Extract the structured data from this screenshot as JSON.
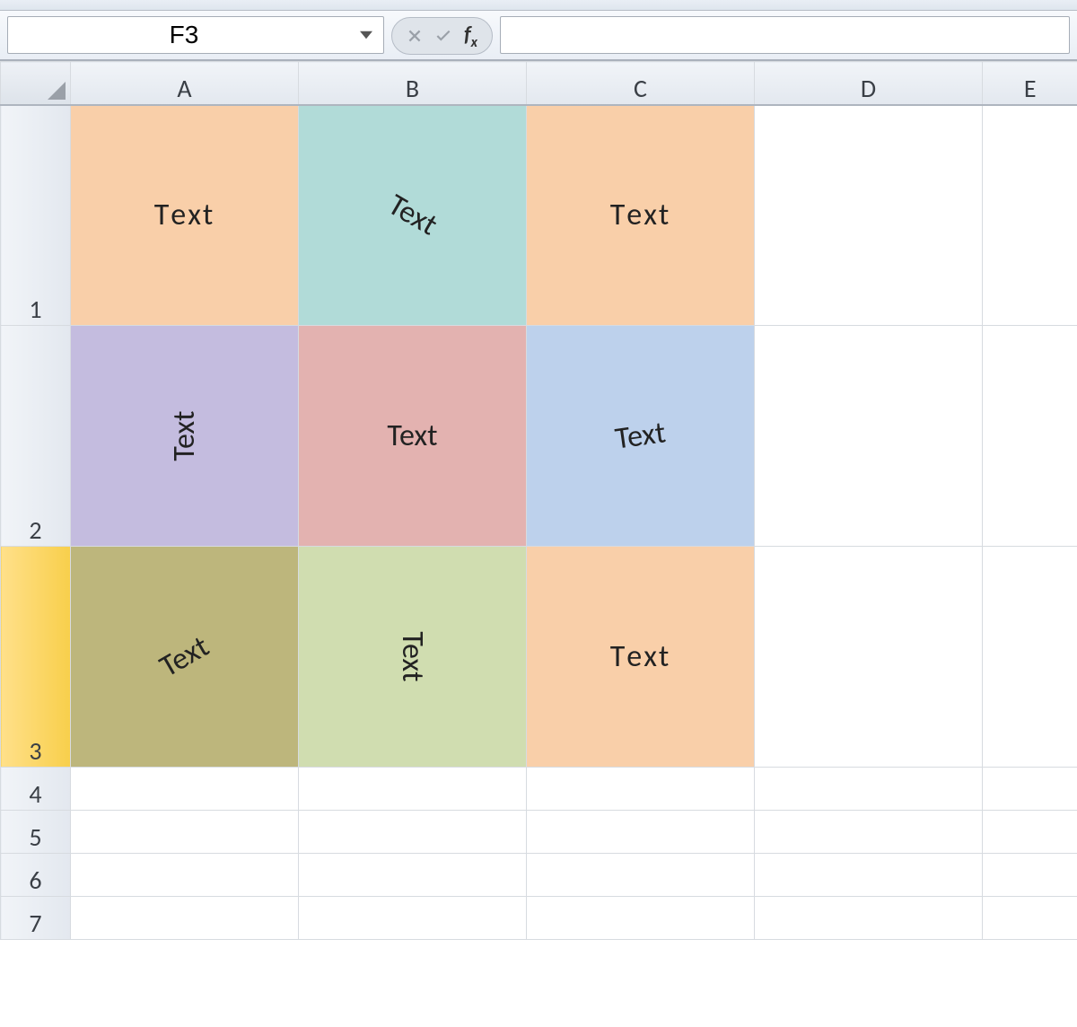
{
  "formula_bar": {
    "cell_reference": "F3",
    "fx_label": "fx",
    "formula_value": ""
  },
  "columns": [
    "A",
    "B",
    "C",
    "D",
    "E"
  ],
  "rows": [
    "1",
    "2",
    "3",
    "4",
    "5",
    "6",
    "7"
  ],
  "selected_row": "3",
  "cells": {
    "A1": {
      "value": "Text",
      "orientation": "stacked",
      "fill": "peach"
    },
    "B1": {
      "value": "Text",
      "orientation": "rotate_up45",
      "fill": "teal"
    },
    "C1": {
      "value": "Text",
      "orientation": "stacked",
      "fill": "peach"
    },
    "A2": {
      "value": "Text",
      "orientation": "rotate_90ccw",
      "fill": "lav"
    },
    "B2": {
      "value": "Text",
      "orientation": "horizontal",
      "fill": "rose"
    },
    "C2": {
      "value": "Text",
      "orientation": "slight_ccw",
      "fill": "blue"
    },
    "A3": {
      "value": "Text",
      "orientation": "rotate_dn45",
      "fill": "olive"
    },
    "B3": {
      "value": "Text",
      "orientation": "rotate_90cw",
      "fill": "sage"
    },
    "C3": {
      "value": "Text",
      "orientation": "stacked",
      "fill": "peach"
    }
  }
}
